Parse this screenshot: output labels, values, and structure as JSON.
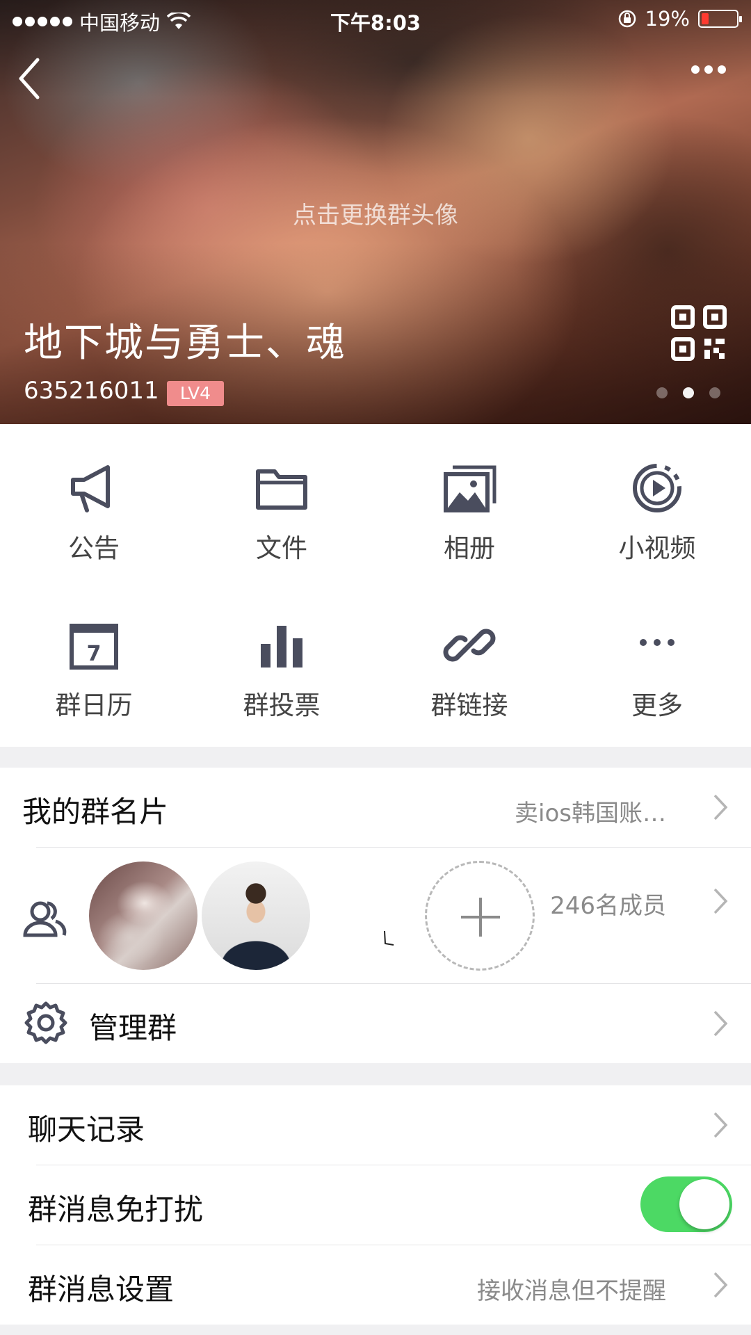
{
  "status_bar": {
    "carrier": "中国移动",
    "time": "下午8:03",
    "battery_percent": "19%",
    "battery_level": 0.19,
    "battery_color": "#ff3b30"
  },
  "header": {
    "avatar_hint": "点击更换群头像",
    "group_name": "地下城与勇士、魂",
    "group_id": "635216011",
    "level": "LV4",
    "page_count": 3,
    "active_page": 2
  },
  "features": [
    {
      "label": "公告",
      "icon": "megaphone-icon"
    },
    {
      "label": "文件",
      "icon": "folder-icon"
    },
    {
      "label": "相册",
      "icon": "photo-album-icon"
    },
    {
      "label": "小视频",
      "icon": "video-play-icon"
    },
    {
      "label": "群日历",
      "icon": "calendar-icon",
      "icon_text": "7"
    },
    {
      "label": "群投票",
      "icon": "bar-chart-icon"
    },
    {
      "label": "群链接",
      "icon": "link-icon"
    },
    {
      "label": "更多",
      "icon": "more-dots-icon"
    }
  ],
  "group_card": {
    "title": "我的群名片",
    "value": "卖ios韩国账…"
  },
  "members": {
    "count_label": "246名成员",
    "icon": "members-icon"
  },
  "manage": {
    "title": "管理群",
    "icon": "gear-icon"
  },
  "chat_history": {
    "title": "聊天记录"
  },
  "dnd": {
    "title": "群消息免打扰",
    "enabled": true,
    "toggle_color": "#4cd964"
  },
  "message_settings": {
    "title": "群消息设置",
    "value": "接收消息但不提醒"
  },
  "colors": {
    "icon_gray": "#4a4d5e",
    "level_badge": "#f08c8c"
  }
}
